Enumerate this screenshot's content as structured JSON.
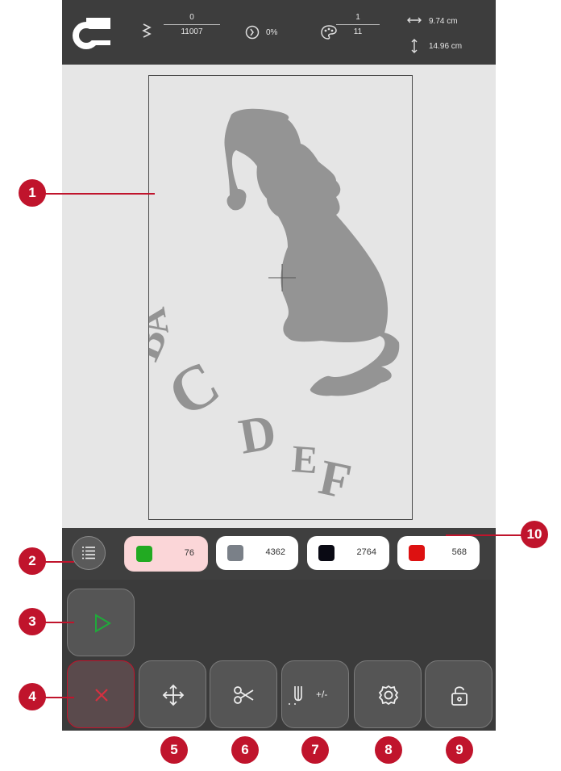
{
  "status": {
    "stitch_current": "0",
    "stitch_total": "11007",
    "progress_percent": "0%",
    "color_current": "1",
    "color_total": "11",
    "width": "9.74 cm",
    "height": "14.96 cm"
  },
  "design_letters": [
    "A",
    "B",
    "C",
    "D",
    "E",
    "F"
  ],
  "color_blocks": [
    {
      "color": "#22aa22",
      "count": "76",
      "selected": true
    },
    {
      "color": "#7a8088",
      "count": "4362",
      "selected": false
    },
    {
      "color": "#0a0a14",
      "count": "2764",
      "selected": false
    },
    {
      "color": "#dd1111",
      "count": "568",
      "selected": false
    }
  ],
  "buttons": [
    "play-icon",
    "close-icon",
    "move-arrows-icon",
    "scissors-icon",
    "needle-adjust-icon",
    "gear-icon",
    "lock-icon"
  ],
  "needle_adjust_label": "+/-",
  "callouts": [
    "1",
    "2",
    "3",
    "4",
    "5",
    "6",
    "7",
    "8",
    "9",
    "10"
  ],
  "colors": {
    "accent_red": "#c0142c",
    "play_green": "#1faa3a"
  }
}
